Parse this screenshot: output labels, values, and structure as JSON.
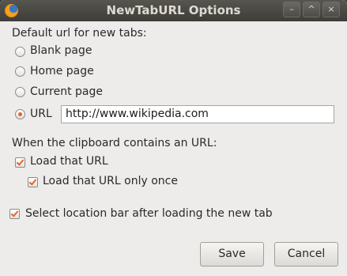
{
  "window": {
    "title": "NewTabURL Options",
    "controls": {
      "minimize": "–",
      "maximize": "^",
      "close": "×"
    }
  },
  "form": {
    "default_url_heading": "Default url for new tabs:",
    "radio_options": [
      "Blank page",
      "Home page",
      "Current page",
      "URL"
    ],
    "selected_option": "URL",
    "url_value": "http://www.wikipedia.com",
    "clipboard_heading": "When the clipboard contains an URL:",
    "checkboxes": {
      "load_url": {
        "label": "Load that URL",
        "checked": true
      },
      "load_once": {
        "label": "Load that URL only once",
        "checked": true
      },
      "select_location": {
        "label": "Select location bar after loading the new tab",
        "checked": true
      }
    }
  },
  "buttons": {
    "save": "Save",
    "cancel": "Cancel"
  },
  "colors": {
    "accent": "#e5652b",
    "titlebar": "#3e3d39",
    "window_bg": "#edeceb"
  }
}
